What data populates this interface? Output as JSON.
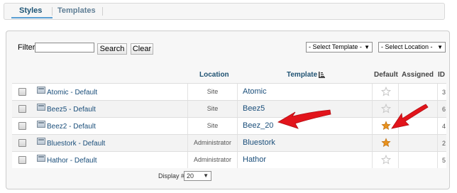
{
  "tabs": [
    {
      "label": "Styles",
      "active": true
    },
    {
      "label": "Templates",
      "active": false
    }
  ],
  "filter": {
    "label": "Filter:",
    "value": "",
    "search_label": "Search",
    "clear_label": "Clear",
    "select_template": "- Select Template -",
    "select_location": "- Select Location -"
  },
  "columns": {
    "location": "Location",
    "template": "Template",
    "default": "Default",
    "assigned": "Assigned",
    "id": "ID"
  },
  "rows": [
    {
      "name": "Atomic - Default",
      "location": "Site",
      "template": "Atomic",
      "default": false,
      "id": "3"
    },
    {
      "name": "Beez5 - Default",
      "location": "Site",
      "template": "Beez5",
      "default": false,
      "id": "6"
    },
    {
      "name": "Beez2 - Default",
      "location": "Site",
      "template": "Beez_20",
      "default": true,
      "id": "4"
    },
    {
      "name": "Bluestork - Default",
      "location": "Administrator",
      "template": "Bluestork",
      "default": true,
      "id": "2"
    },
    {
      "name": "Hathor - Default",
      "location": "Administrator",
      "template": "Hathor",
      "default": false,
      "id": "5"
    }
  ],
  "display": {
    "label": "Display #",
    "value": "20"
  },
  "colors": {
    "star_on": "#e8921e",
    "star_off": "#c8c8c8",
    "arrow": "#e2141b",
    "link": "#1a4e7a"
  },
  "icons": [
    "checkbox",
    "template-icon",
    "star-icon",
    "sort-icon",
    "chevron-down-icon",
    "red-arrow"
  ]
}
